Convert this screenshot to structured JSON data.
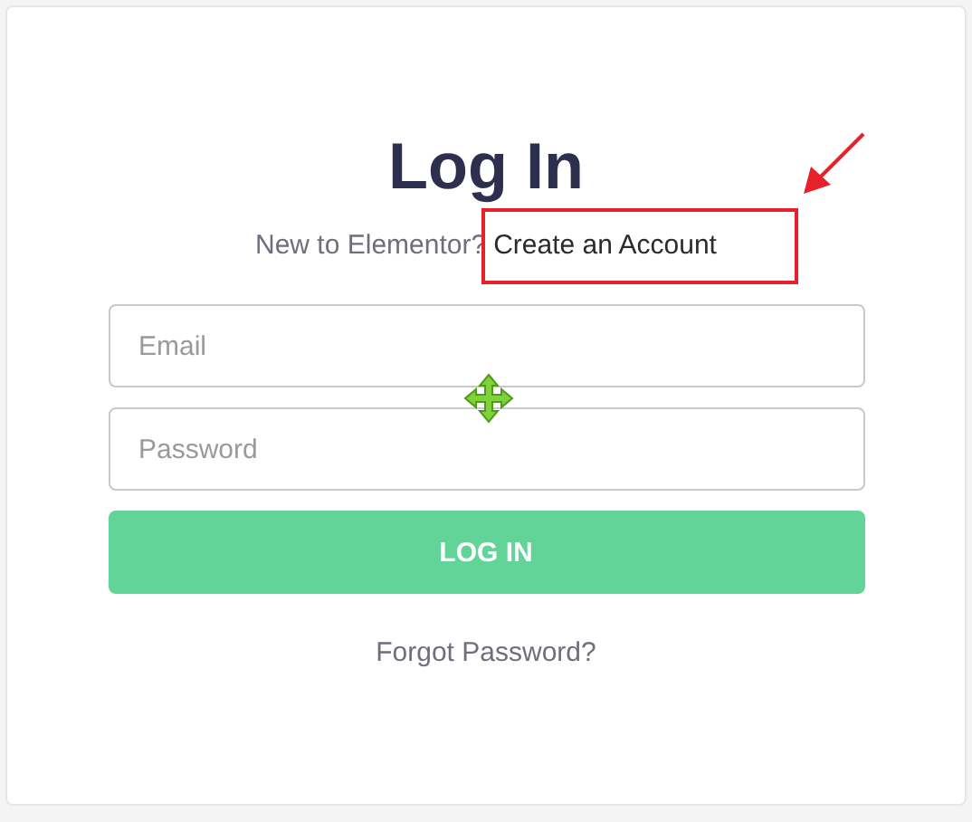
{
  "title": "Log In",
  "signup": {
    "prompt": "New to Elementor?",
    "link": "Create an Account"
  },
  "fields": [
    {
      "placeholder": "Email"
    },
    {
      "placeholder": "Password"
    }
  ],
  "submit": "LOG IN",
  "forgot": "Forgot Password?"
}
